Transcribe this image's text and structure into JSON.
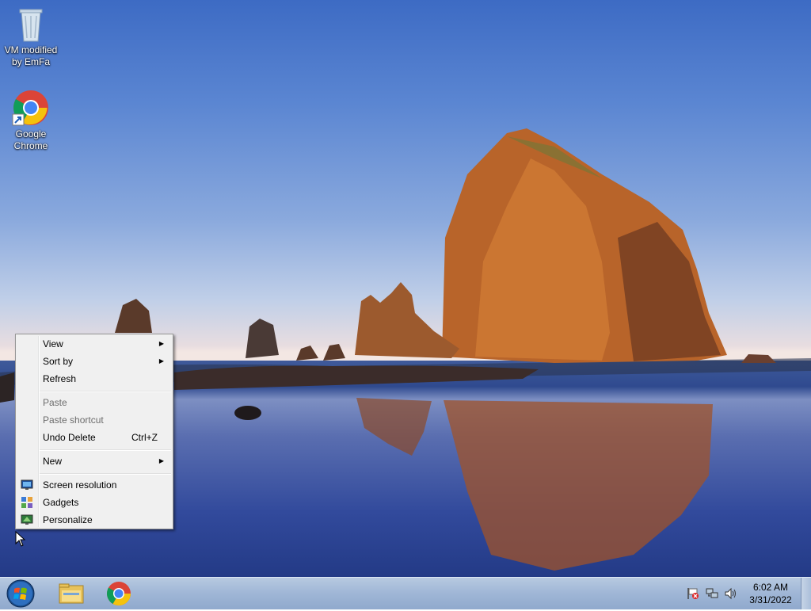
{
  "desktop": {
    "icons": [
      {
        "name": "recycle-bin",
        "label_line1": "VM modified",
        "label_line2": "by EmFa",
        "icon": "recycle-bin-icon"
      },
      {
        "name": "google-chrome",
        "label_line1": "Google",
        "label_line2": "Chrome",
        "icon": "chrome-icon"
      }
    ]
  },
  "context_menu": {
    "view": "View",
    "sort_by": "Sort by",
    "refresh": "Refresh",
    "paste": "Paste",
    "paste_shortcut": "Paste shortcut",
    "undo_delete": "Undo Delete",
    "undo_delete_shortcut": "Ctrl+Z",
    "new": "New",
    "screen_resolution": "Screen resolution",
    "gadgets": "Gadgets",
    "personalize": "Personalize",
    "submenu_arrow": "▶"
  },
  "taskbar": {
    "start": "start-orb-icon",
    "pinned": [
      "file-explorer-icon",
      "chrome-icon"
    ],
    "tray_icons": [
      "action-center-flag-icon",
      "network-icon",
      "volume-icon"
    ],
    "clock_time": "6:02 AM",
    "clock_date": "3/31/2022"
  },
  "colors": {
    "taskbar": "#9fb6d6",
    "menu_bg": "#f0f0f0",
    "menu_border": "#979797"
  }
}
